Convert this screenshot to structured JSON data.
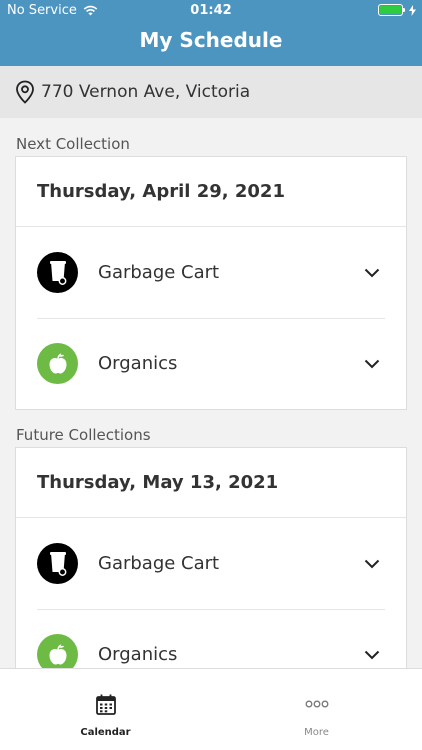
{
  "status_bar": {
    "carrier": "No Service",
    "time": "01:42"
  },
  "header": {
    "title": "My Schedule"
  },
  "address": {
    "text": "770 Vernon Ave, Victoria"
  },
  "next": {
    "label": "Next Collection",
    "date": "Thursday, April 29, 2021",
    "items": [
      {
        "label": "Garbage Cart",
        "icon": "garbage-cart-icon"
      },
      {
        "label": "Organics",
        "icon": "organics-apple-icon"
      }
    ]
  },
  "future": {
    "label": "Future Collections",
    "date": "Thursday, May 13, 2021",
    "items": [
      {
        "label": "Garbage Cart",
        "icon": "garbage-cart-icon"
      },
      {
        "label": "Organics",
        "icon": "organics-apple-icon"
      }
    ]
  },
  "tabs": [
    {
      "label": "Calendar",
      "icon": "calendar-icon",
      "active": true
    },
    {
      "label": "More",
      "icon": "more-icon",
      "active": false
    }
  ],
  "colors": {
    "header": "#4d95c1",
    "organics": "#6dbb45",
    "garbage": "#000000"
  }
}
